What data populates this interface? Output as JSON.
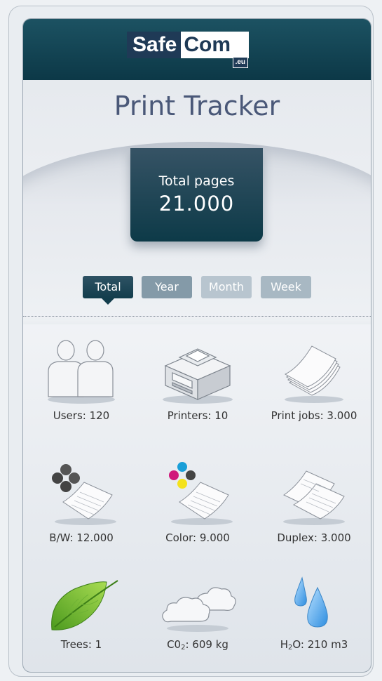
{
  "header": {
    "logo_part1": "Safe",
    "logo_part2": "Com",
    "logo_suffix": ".eu"
  },
  "title": "Print Tracker",
  "total": {
    "label": "Total pages",
    "value": "21.000"
  },
  "tabs": [
    {
      "label": "Total",
      "active": true
    },
    {
      "label": "Year",
      "active": false
    },
    {
      "label": "Month",
      "active": false
    },
    {
      "label": "Week",
      "active": false
    }
  ],
  "stats": {
    "users": "Users: 120",
    "printers": "Printers: 10",
    "print_jobs": "Print jobs: 3.000",
    "bw": "B/W: 12.000",
    "color": "Color: 9.000",
    "duplex": "Duplex: 3.000",
    "trees": "Trees: 1",
    "co2_prefix": "C0",
    "co2_sub": "2",
    "co2_value": ": 609 kg",
    "h2o_prefix": "H",
    "h2o_sub": "2",
    "h2o_value": "O: 210 m3"
  },
  "icons": [
    "users-icon",
    "printer-icon",
    "paper-stack-icon",
    "bw-toner-icon",
    "color-toner-icon",
    "duplex-icon",
    "leaf-icon",
    "cloud-icon",
    "water-drops-icon"
  ],
  "colors": {
    "header": "#0c3847",
    "accent": "#1f3a56",
    "cyan": "#1a9fd8",
    "magenta": "#d0177b",
    "yellow": "#f4e21c",
    "leaf": "#5aa82a",
    "water": "#4da3e8"
  }
}
